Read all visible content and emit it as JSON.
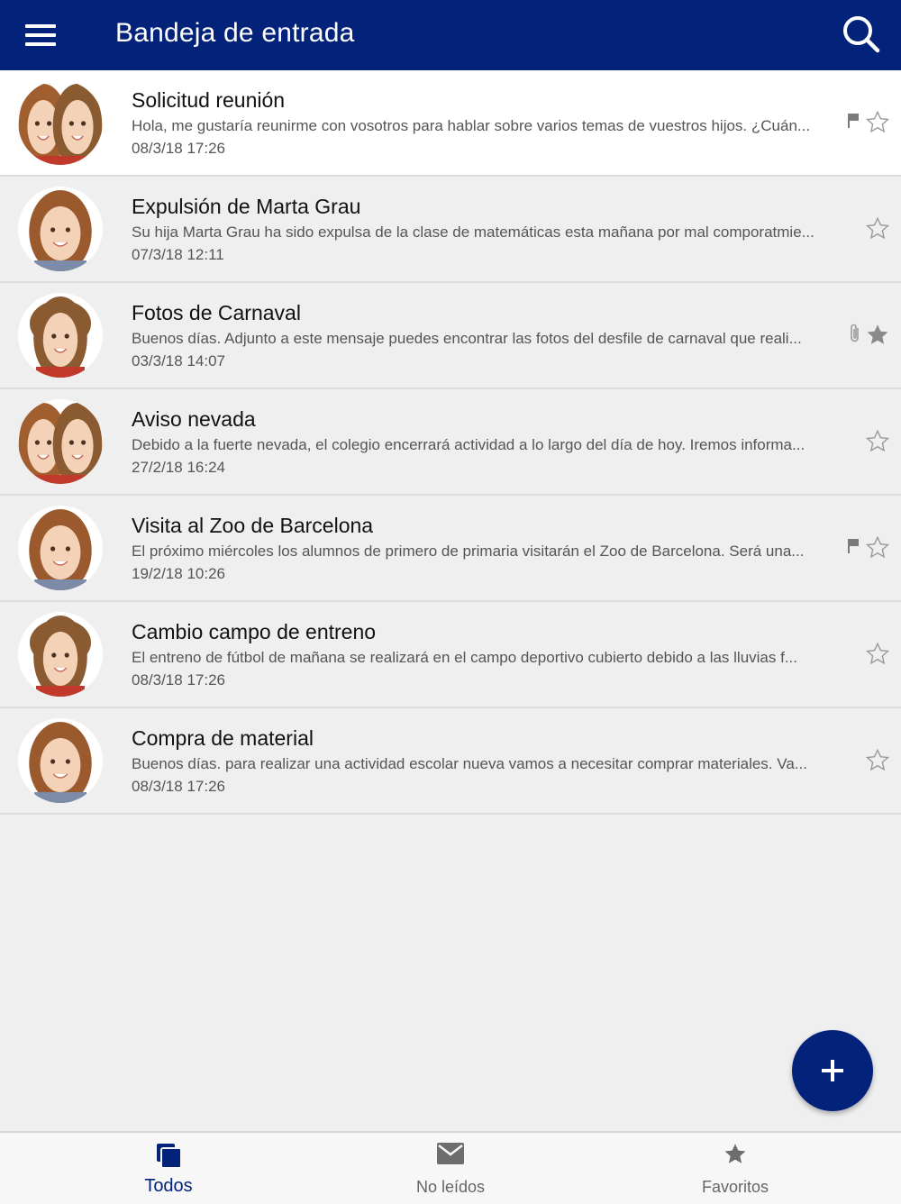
{
  "header": {
    "title": "Bandeja de entrada"
  },
  "icons": {
    "menu": "menu-icon",
    "search": "search-icon",
    "add": "plus-icon"
  },
  "colors": {
    "primary": "#03237a",
    "unread_bg": "#ffffff",
    "read_bg": "#efefef"
  },
  "messages": [
    {
      "subject": "Solicitud reunión",
      "preview": "Hola, me gustaría reunirme con vosotros para hablar sobre varios temas de vuestros hijos. ¿Cuán...",
      "date": "08/3/18  17:26",
      "avatar": "two-children",
      "unread": true,
      "flag": true,
      "attachment": false,
      "starred": false
    },
    {
      "subject": "Expulsión de Marta Grau",
      "preview": "Su hija Marta Grau ha sido expulsa de la clase de matemáticas esta mañana por mal comporatmie...",
      "date": "07/3/18  12:11",
      "avatar": "girl",
      "unread": false,
      "flag": false,
      "attachment": false,
      "starred": false
    },
    {
      "subject": "Fotos de Carnaval",
      "preview": "Buenos días. Adjunto a este mensaje  puedes encontrar las fotos del desfile de carnaval que reali...",
      "date": "03/3/18  14:07",
      "avatar": "boy",
      "unread": false,
      "flag": false,
      "attachment": true,
      "starred": true
    },
    {
      "subject": "Aviso nevada",
      "preview": "Debido a la fuerte nevada, el colegio encerrará actividad a lo largo del día de hoy. Iremos informa...",
      "date": "27/2/18  16:24",
      "avatar": "two-children",
      "unread": false,
      "flag": false,
      "attachment": false,
      "starred": false
    },
    {
      "subject": "Visita al Zoo de Barcelona",
      "preview": "El próximo miércoles los alumnos de primero de primaria visitarán el Zoo de Barcelona. Será una...",
      "date": "19/2/18  10:26",
      "avatar": "girl",
      "unread": false,
      "flag": true,
      "attachment": false,
      "starred": false
    },
    {
      "subject": "Cambio campo de entreno",
      "preview": "El entreno de fútbol de mañana se realizará en el campo deportivo cubierto debido a las lluvias f...",
      "date": "08/3/18  17:26",
      "avatar": "boy",
      "unread": false,
      "flag": false,
      "attachment": false,
      "starred": false
    },
    {
      "subject": "Compra de material",
      "preview": "Buenos días. para realizar una actividad escolar nueva vamos a necesitar comprar materiales. Va...",
      "date": "08/3/18  17:26",
      "avatar": "girl",
      "unread": false,
      "flag": false,
      "attachment": false,
      "starred": false
    }
  ],
  "tabs": [
    {
      "label": "Todos",
      "icon": "stack-icon",
      "active": true
    },
    {
      "label": "No leídos",
      "icon": "envelope-icon",
      "active": false
    },
    {
      "label": "Favoritos",
      "icon": "star-icon",
      "active": false
    }
  ]
}
